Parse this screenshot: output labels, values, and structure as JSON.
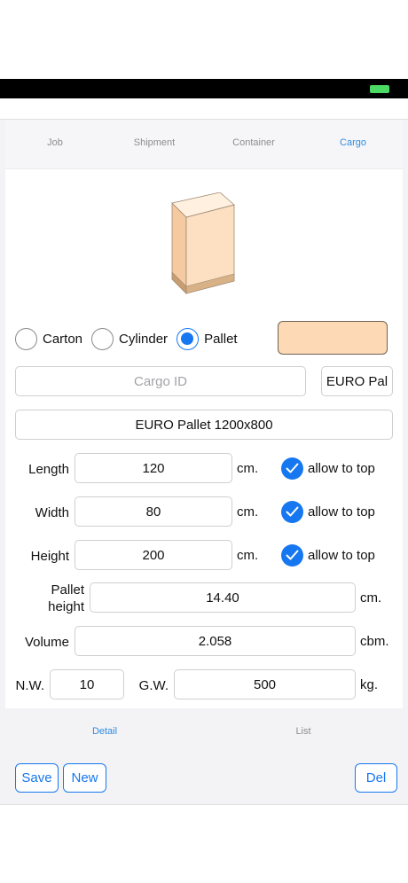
{
  "tabs": [
    "Job",
    "Shipment",
    "Container",
    "Cargo"
  ],
  "active_tab": "Cargo",
  "cargo_type": {
    "options": [
      "Carton",
      "Cylinder",
      "Pallet"
    ],
    "selected": "Pallet"
  },
  "cargo_color": "#fdd9b5",
  "cargo_id": {
    "value": "",
    "placeholder": "Cargo ID"
  },
  "preset_button": "EURO Pal",
  "cargo_name": "EURO Pallet 1200x800",
  "dimensions": {
    "length": {
      "label": "Length",
      "value": "120",
      "unit": "cm.",
      "allow_to_top": "allow to top"
    },
    "width": {
      "label": "Width",
      "value": "80",
      "unit": "cm.",
      "allow_to_top": "allow to top"
    },
    "height": {
      "label": "Height",
      "value": "200",
      "unit": "cm.",
      "allow_to_top": "allow to top"
    }
  },
  "pallet_height": {
    "label_line1": "Pallet",
    "label_line2": "height",
    "value": "14.40",
    "unit": "cm."
  },
  "volume": {
    "label": "Volume",
    "value": "2.058",
    "unit": "cbm."
  },
  "weights": {
    "nw_label": "N.W.",
    "nw_value": "10",
    "gw_label": "G.W.",
    "gw_value": "500",
    "unit": "kg."
  },
  "bottom_tabs": [
    "Detail",
    "List"
  ],
  "active_bottom_tab": "Detail",
  "buttons": {
    "save": "Save",
    "new": "New",
    "delete": "Del"
  },
  "colors": {
    "accent": "#1677f0",
    "tab_active": "#2f8be0"
  }
}
